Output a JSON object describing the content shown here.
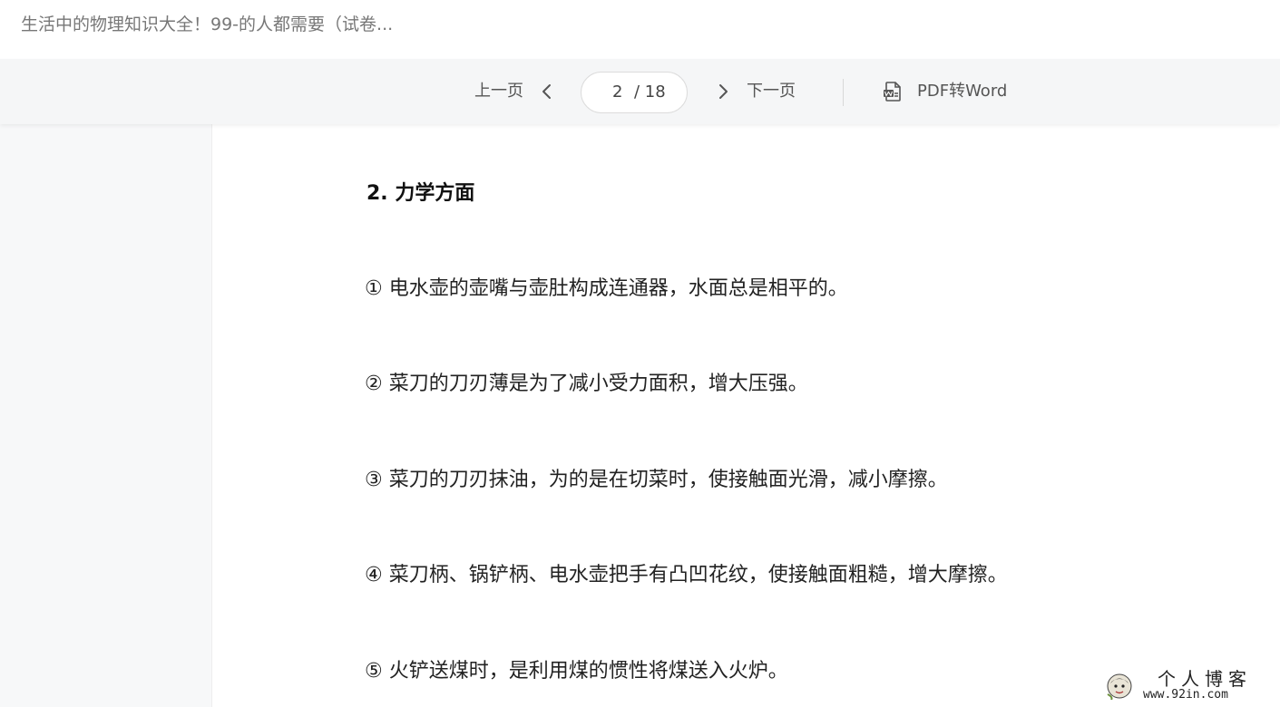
{
  "document": {
    "title": "生活中的物理知识大全！99-的人都需要（试卷..."
  },
  "toolbar": {
    "prev_label": "上一页",
    "next_label": "下一页",
    "current_page": "2",
    "page_separator": "/ 18",
    "total_pages": 18,
    "convert_label": "PDF转Word",
    "prev_icon": "chevron-left-icon",
    "next_icon": "chevron-right-icon",
    "convert_icon": "word-document-icon"
  },
  "content": {
    "heading": "2. 力学方面",
    "paragraphs": [
      "① 电水壶的壶嘴与壶肚构成连通器，水面总是相平的。",
      "② 菜刀的刀刃薄是为了减小受力面积，增大压强。",
      "③ 菜刀的刀刃抹油，为的是在切菜时，使接触面光滑，减小摩擦。",
      "④ 菜刀柄、锅铲柄、电水壶把手有凸凹花纹，使接触面粗糙，增大摩擦。",
      "⑤ 火铲送煤时，是利用煤的惯性将煤送入火炉。"
    ]
  },
  "watermark": {
    "line1": "个人博客",
    "line2": "www.92in.com"
  },
  "colors": {
    "toolbar_bg": "#f5f6f7",
    "rail_bg": "#f7f8f9",
    "page_bg": "#ffffff",
    "text_primary": "#222222",
    "text_muted": "#777777"
  }
}
